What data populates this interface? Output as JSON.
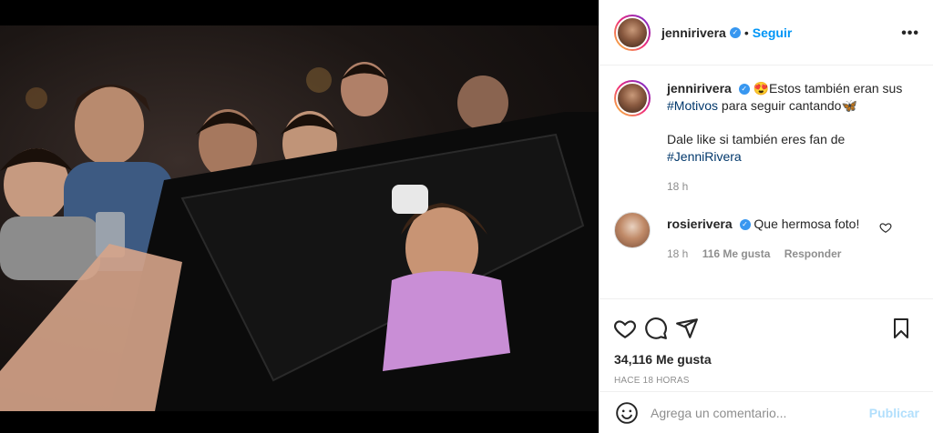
{
  "post": {
    "author": {
      "username": "jennirivera",
      "verified": true,
      "follow_label": "Seguir",
      "dot": "•"
    },
    "more_label": "•••",
    "caption": {
      "emoji": "😍",
      "text_1": "Estos también eran sus ",
      "hashtag_1": "#Motivos",
      "text_2": " para seguir cantando",
      "emoji_end": "🦋",
      "text_3": "Dale like si también eres fan de ",
      "hashtag_2": "#JenniRivera",
      "time": "18 h"
    },
    "comments": [
      {
        "username": "rosierivera",
        "verified": true,
        "text": "Que hermosa foto!",
        "time": "18 h",
        "likes": "116 Me gusta",
        "reply_label": "Responder"
      }
    ],
    "likes_count": "34,116 Me gusta",
    "posted_ago": "HACE 18 HORAS",
    "composer": {
      "placeholder": "Agrega un comentario...",
      "publish_label": "Publicar"
    }
  },
  "colors": {
    "link": "#0095f6",
    "hashtag": "#00376b",
    "verified": "#3897f0",
    "muted": "#8e8e8e",
    "publish_disabled": "#b2dffc"
  },
  "icons": [
    "heart-icon",
    "comment-icon",
    "share-icon",
    "bookmark-icon",
    "emoji-icon",
    "more-icon",
    "verified-icon"
  ]
}
